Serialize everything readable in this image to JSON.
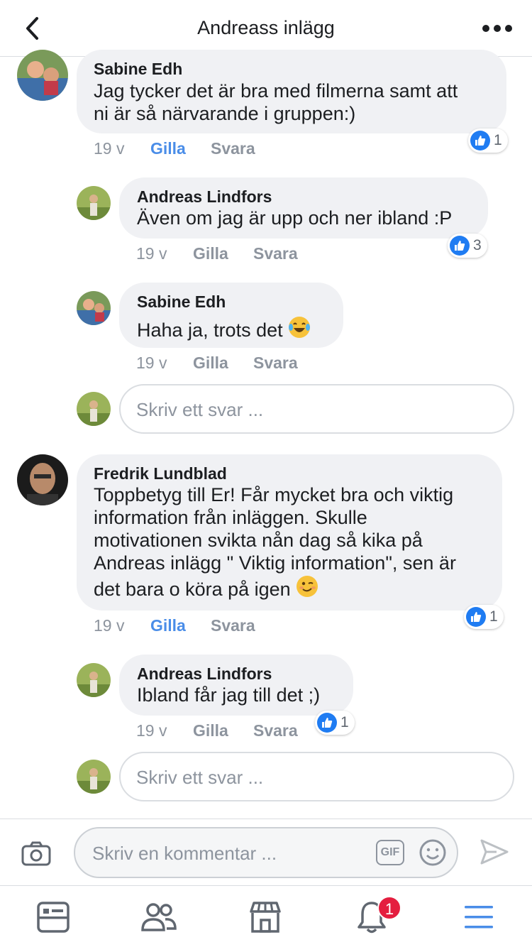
{
  "header": {
    "title": "Andreass inlägg",
    "back_icon": "chevron-left-icon",
    "more_icon": "more-dots-icon"
  },
  "comments": [
    {
      "author": "Sabine Edh",
      "lines": [
        "Jag tycker det är bra med filmerna samt att",
        "ni är så närvarande i gruppen:)"
      ],
      "time": "19 v",
      "like_label": "Gilla",
      "liked": true,
      "reply_label": "Svara",
      "reaction_count": "1"
    },
    {
      "author": "Andreas Lindfors",
      "lines": [
        "Även om jag är upp och ner ibland :P"
      ],
      "time": "19 v",
      "like_label": "Gilla",
      "reply_label": "Svara",
      "reaction_count": "3"
    },
    {
      "author": "Sabine Edh",
      "lines": [
        "Haha ja, trots det"
      ],
      "emoji": "laughing-tears-emoji",
      "time": "19 v",
      "like_label": "Gilla",
      "reply_label": "Svara"
    },
    {
      "author": "Fredrik Lundblad",
      "lines": [
        "Toppbetyg till Er! Får mycket bra och viktig",
        "information från inläggen. Skulle",
        "motivationen svikta nån dag så kika på",
        "Andreas inlägg \" Viktig information\", sen är",
        "det bara o köra på igen"
      ],
      "emoji": "wink-emoji",
      "time": "19 v",
      "like_label": "Gilla",
      "liked": true,
      "reply_label": "Svara",
      "reaction_count": "1"
    },
    {
      "author": "Andreas Lindfors",
      "lines": [
        "Ibland får jag till det ;)"
      ],
      "time": "19 v",
      "like_label": "Gilla",
      "reply_label": "Svara",
      "reaction_count": "1"
    }
  ],
  "reply_placeholder": "Skriv ett svar ...",
  "composer": {
    "placeholder": "Skriv en kommentar ...",
    "gif_label": "GIF"
  },
  "tabs": {
    "notifications_badge": "1"
  },
  "colors": {
    "accent": "#4a8de8",
    "like_blue": "#1f7cf2",
    "bubble": "#f0f1f4",
    "badge": "#e41e3f",
    "muted": "#8d949e"
  }
}
